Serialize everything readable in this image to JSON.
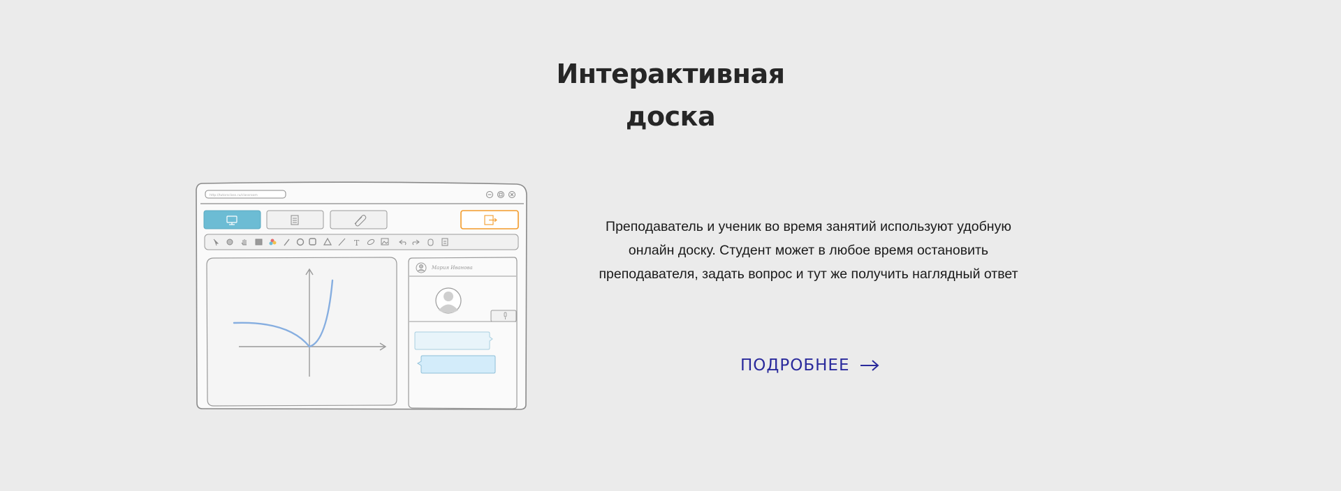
{
  "section": {
    "title_line1": "Интерактивная",
    "title_line2": "доска"
  },
  "whiteboard_mockup": {
    "url_text": "http://tutorsclass.ru/classroom",
    "user_name": "Мария Иванова",
    "text_tool_glyph": "T",
    "tab_colors": {
      "active": "#6cbcd4",
      "exit": "#f39b2a"
    },
    "curve_color": "#86aee0"
  },
  "description": {
    "text": "Преподаватель и ученик во время занятий используют удобную онлайн доску.  Студент может в любое время остановить преподавателя, задать вопрос и тут же получить наглядный ответ"
  },
  "cta": {
    "label": "ПОДРОБНЕЕ",
    "color": "#2a2a9c"
  }
}
